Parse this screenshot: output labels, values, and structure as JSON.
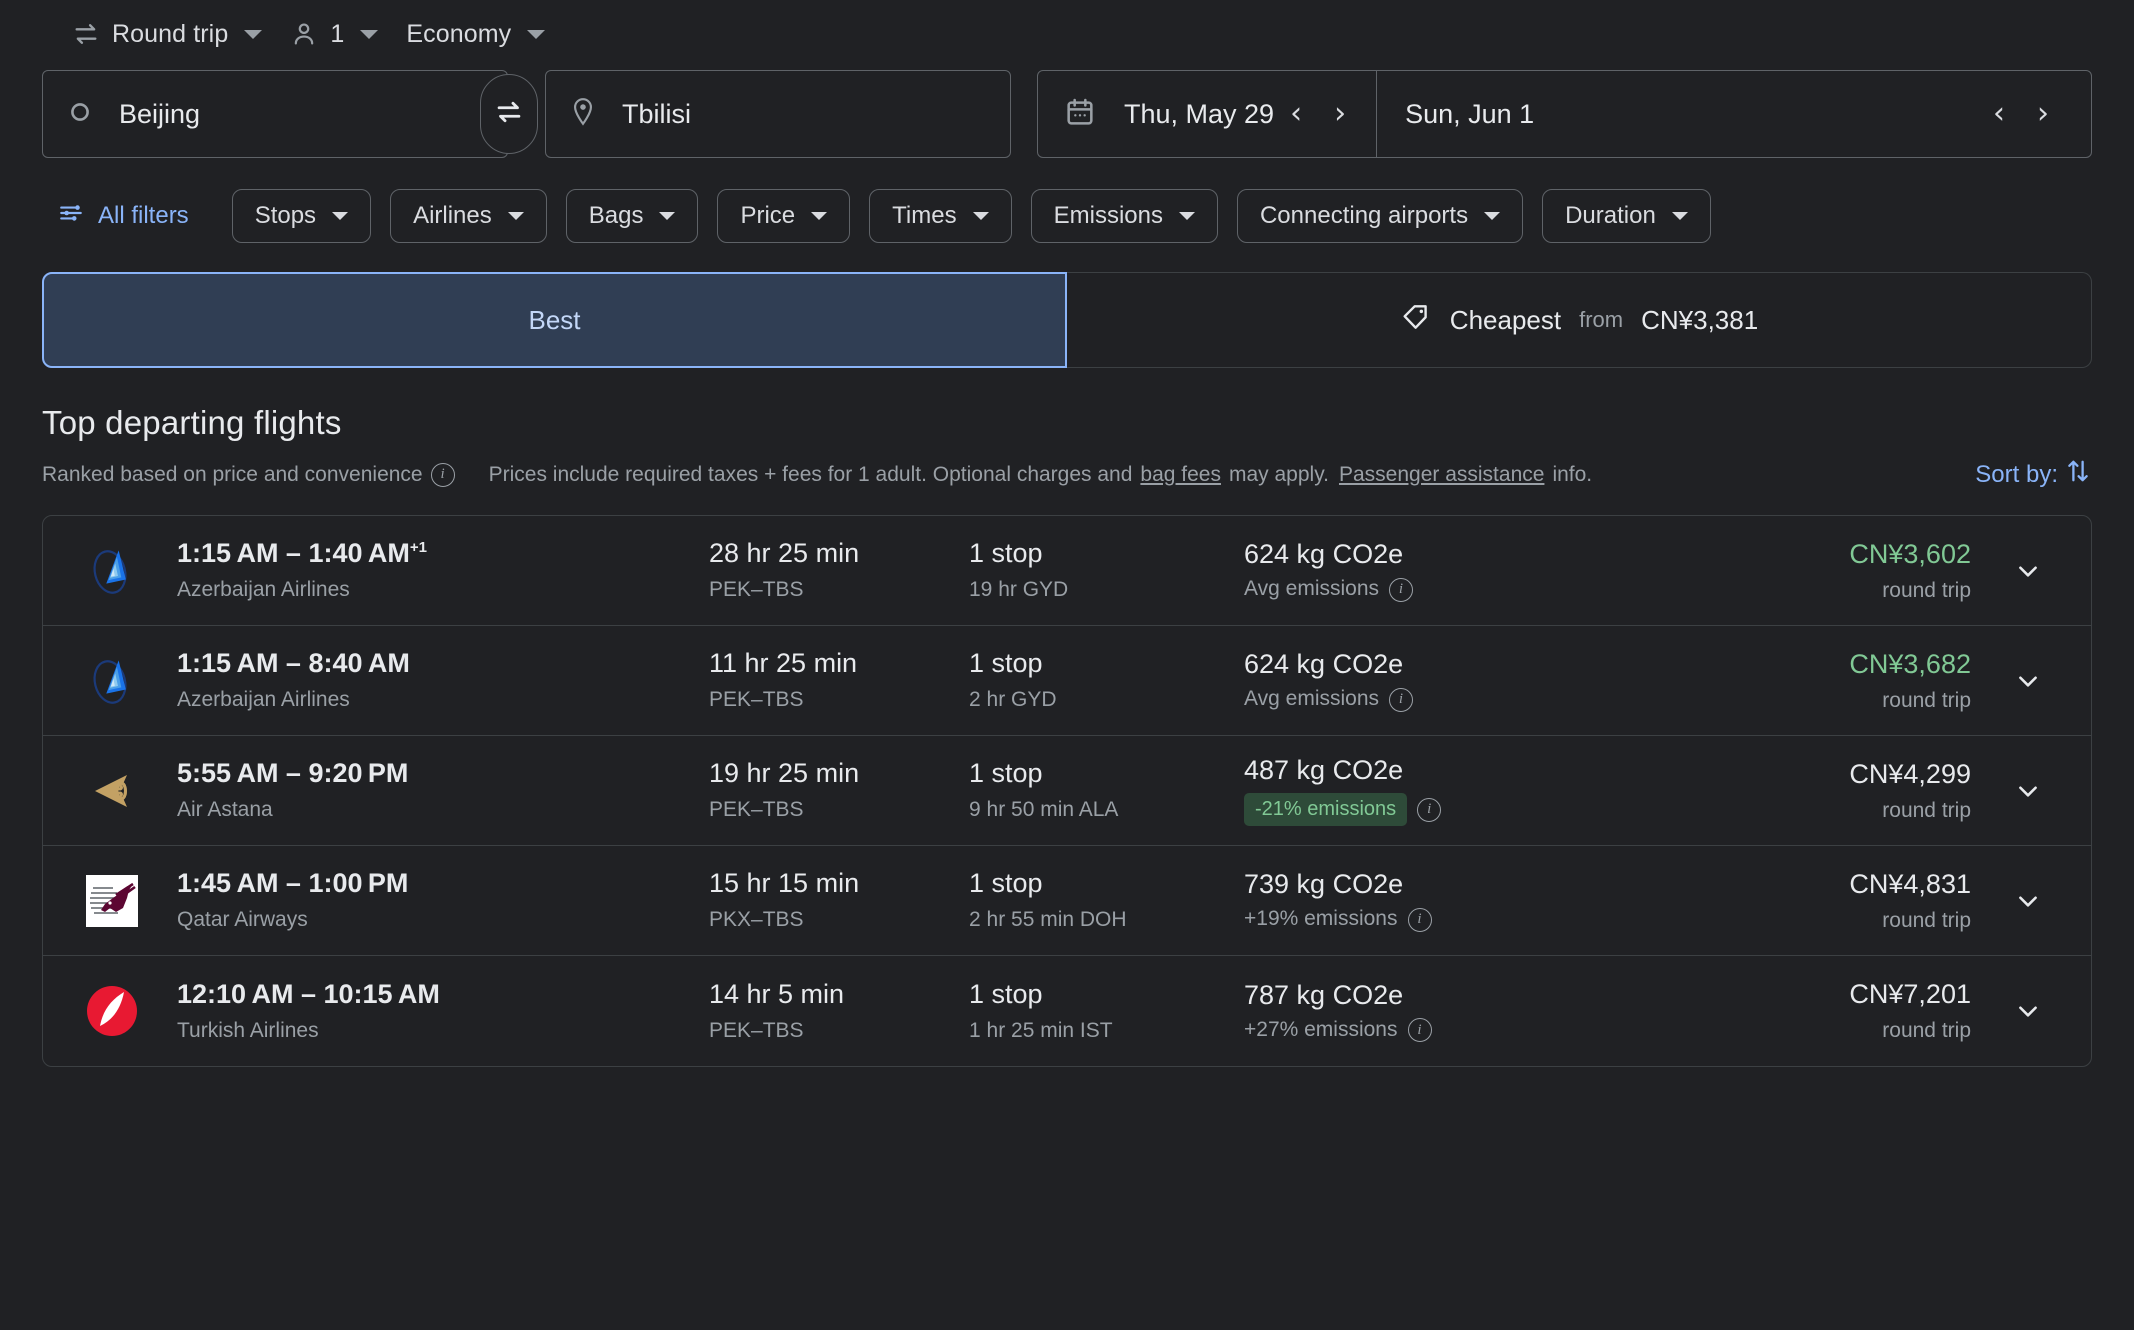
{
  "options": {
    "trip_type": "Round trip",
    "trip_type_icon": "swap-horizontal-icon",
    "passengers": "1",
    "passengers_icon": "person-icon",
    "cabin_class": "Economy"
  },
  "search": {
    "origin_icon": "circle-outline-icon",
    "origin": "Beijing",
    "swap_icon": "swap-arrows-icon",
    "destination_icon": "location-pin-icon",
    "destination": "Tbilisi",
    "calendar_icon": "calendar-icon",
    "depart_date": "Thu, May 29",
    "return_date": "Sun, Jun 1",
    "prev_arrow": "‹",
    "next_arrow": "›"
  },
  "filters": {
    "all_filters_label": "All filters",
    "all_filters_icon": "tune-icon",
    "chips": [
      {
        "label": "Stops"
      },
      {
        "label": "Airlines"
      },
      {
        "label": "Bags"
      },
      {
        "label": "Price"
      },
      {
        "label": "Times"
      },
      {
        "label": "Emissions"
      },
      {
        "label": "Connecting airports"
      },
      {
        "label": "Duration"
      }
    ]
  },
  "tabs": {
    "best": "Best",
    "cheapest": "Cheapest",
    "cheapest_icon": "price-tag-icon",
    "cheapest_from_label": "from",
    "cheapest_price": "CN¥3,381"
  },
  "section": {
    "title": "Top departing flights",
    "ranked_text": "Ranked based on price and convenience",
    "prices_note_1": "Prices include required taxes + fees for 1 adult. Optional charges and",
    "bag_fees_link": "bag fees",
    "prices_note_2": "may apply.",
    "passenger_assistance_link": "Passenger assistance",
    "prices_note_3": "info.",
    "sort_by_label": "Sort by:",
    "sort_icon": "sort-arrows-icon"
  },
  "flights": [
    {
      "logo": "azerbaijan-airlines-logo",
      "times": "1:15 AM – 1:40 AM",
      "plus_days": "+1",
      "airline": "Azerbaijan Airlines",
      "duration": "28 hr 25 min",
      "route": "PEK–TBS",
      "stops": "1 stop",
      "layover": "19 hr GYD",
      "co2": "624 kg CO2e",
      "emissions_note": "Avg emissions",
      "emissions_badge": "",
      "price": "CN¥3,602",
      "price_green": true,
      "price_sub": "round trip"
    },
    {
      "logo": "azerbaijan-airlines-logo",
      "times": "1:15 AM – 8:40 AM",
      "plus_days": "",
      "airline": "Azerbaijan Airlines",
      "duration": "11 hr 25 min",
      "route": "PEK–TBS",
      "stops": "1 stop",
      "layover": "2 hr GYD",
      "co2": "624 kg CO2e",
      "emissions_note": "Avg emissions",
      "emissions_badge": "",
      "price": "CN¥3,682",
      "price_green": true,
      "price_sub": "round trip"
    },
    {
      "logo": "air-astana-logo",
      "times": "5:55 AM – 9:20 PM",
      "plus_days": "",
      "airline": "Air Astana",
      "duration": "19 hr 25 min",
      "route": "PEK–TBS",
      "stops": "1 stop",
      "layover": "9 hr 50 min ALA",
      "co2": "487 kg CO2e",
      "emissions_note": "",
      "emissions_badge": "-21% emissions",
      "price": "CN¥4,299",
      "price_green": false,
      "price_sub": "round trip"
    },
    {
      "logo": "qatar-airways-logo",
      "times": "1:45 AM – 1:00 PM",
      "plus_days": "",
      "airline": "Qatar Airways",
      "duration": "15 hr 15 min",
      "route": "PKX–TBS",
      "stops": "1 stop",
      "layover": "2 hr 55 min DOH",
      "co2": "739 kg CO2e",
      "emissions_note": "+19% emissions",
      "emissions_badge": "",
      "price": "CN¥4,831",
      "price_green": false,
      "price_sub": "round trip"
    },
    {
      "logo": "turkish-airlines-logo",
      "times": "12:10 AM – 10:15 AM",
      "plus_days": "",
      "airline": "Turkish Airlines",
      "duration": "14 hr 5 min",
      "route": "PEK–TBS",
      "stops": "1 stop",
      "layover": "1 hr 25 min IST",
      "co2": "787 kg CO2e",
      "emissions_note": "+27% emissions",
      "emissions_badge": "",
      "price": "CN¥7,201",
      "price_green": false,
      "price_sub": "round trip"
    }
  ],
  "colors": {
    "background": "#202124",
    "accent_blue": "#8ab4f8",
    "price_green": "#81c995",
    "badge_bg": "#2e4b39",
    "border": "#3c4043",
    "muted_text": "#9aa0a6"
  }
}
